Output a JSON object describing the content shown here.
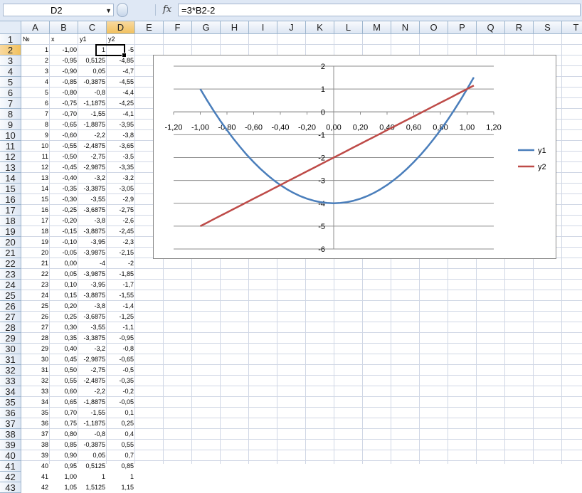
{
  "formula_bar": {
    "name_box": "D2",
    "fx_label": "fx",
    "formula": "=3*B2-2"
  },
  "columns": [
    "A",
    "B",
    "C",
    "D",
    "E",
    "F",
    "G",
    "H",
    "I",
    "J",
    "K",
    "L",
    "M",
    "N",
    "O",
    "P",
    "Q",
    "R",
    "S",
    "T"
  ],
  "selected_column": "D",
  "selected_row": 2,
  "rows": [
    1,
    2,
    3,
    4,
    5,
    6,
    7,
    8,
    9,
    10,
    11,
    12,
    13,
    14,
    15,
    16,
    17,
    18,
    19,
    20,
    21,
    22,
    23,
    24,
    25,
    26,
    27,
    28,
    29,
    30,
    31,
    32,
    33,
    34,
    35,
    36,
    37,
    38,
    39,
    40,
    41,
    42,
    43
  ],
  "header_row": [
    "№",
    "x",
    "y1",
    "y2"
  ],
  "table": [
    [
      "1",
      "-1,00",
      "1",
      "-5"
    ],
    [
      "2",
      "-0,95",
      "0,5125",
      "-4,85"
    ],
    [
      "3",
      "-0,90",
      "0,05",
      "-4,7"
    ],
    [
      "4",
      "-0,85",
      "-0,3875",
      "-4,55"
    ],
    [
      "5",
      "-0,80",
      "-0,8",
      "-4,4"
    ],
    [
      "6",
      "-0,75",
      "-1,1875",
      "-4,25"
    ],
    [
      "7",
      "-0,70",
      "-1,55",
      "-4,1"
    ],
    [
      "8",
      "-0,65",
      "-1,8875",
      "-3,95"
    ],
    [
      "9",
      "-0,60",
      "-2,2",
      "-3,8"
    ],
    [
      "10",
      "-0,55",
      "-2,4875",
      "-3,65"
    ],
    [
      "11",
      "-0,50",
      "-2,75",
      "-3,5"
    ],
    [
      "12",
      "-0,45",
      "-2,9875",
      "-3,35"
    ],
    [
      "13",
      "-0,40",
      "-3,2",
      "-3,2"
    ],
    [
      "14",
      "-0,35",
      "-3,3875",
      "-3,05"
    ],
    [
      "15",
      "-0,30",
      "-3,55",
      "-2,9"
    ],
    [
      "16",
      "-0,25",
      "-3,6875",
      "-2,75"
    ],
    [
      "17",
      "-0,20",
      "-3,8",
      "-2,6"
    ],
    [
      "18",
      "-0,15",
      "-3,8875",
      "-2,45"
    ],
    [
      "19",
      "-0,10",
      "-3,95",
      "-2,3"
    ],
    [
      "20",
      "-0,05",
      "-3,9875",
      "-2,15"
    ],
    [
      "21",
      "0,00",
      "-4",
      "-2"
    ],
    [
      "22",
      "0,05",
      "-3,9875",
      "-1,85"
    ],
    [
      "23",
      "0,10",
      "-3,95",
      "-1,7"
    ],
    [
      "24",
      "0,15",
      "-3,8875",
      "-1,55"
    ],
    [
      "25",
      "0,20",
      "-3,8",
      "-1,4"
    ],
    [
      "26",
      "0,25",
      "-3,6875",
      "-1,25"
    ],
    [
      "27",
      "0,30",
      "-3,55",
      "-1,1"
    ],
    [
      "28",
      "0,35",
      "-3,3875",
      "-0,95"
    ],
    [
      "29",
      "0,40",
      "-3,2",
      "-0,8"
    ],
    [
      "30",
      "0,45",
      "-2,9875",
      "-0,65"
    ],
    [
      "31",
      "0,50",
      "-2,75",
      "-0,5"
    ],
    [
      "32",
      "0,55",
      "-2,4875",
      "-0,35"
    ],
    [
      "33",
      "0,60",
      "-2,2",
      "-0,2"
    ],
    [
      "34",
      "0,65",
      "-1,8875",
      "-0,05"
    ],
    [
      "35",
      "0,70",
      "-1,55",
      "0,1"
    ],
    [
      "36",
      "0,75",
      "-1,1875",
      "0,25"
    ],
    [
      "37",
      "0,80",
      "-0,8",
      "0,4"
    ],
    [
      "38",
      "0,85",
      "-0,3875",
      "0,55"
    ],
    [
      "39",
      "0,90",
      "0,05",
      "0,7"
    ],
    [
      "40",
      "0,95",
      "0,5125",
      "0,85"
    ],
    [
      "41",
      "1,00",
      "1",
      "1"
    ],
    [
      "42",
      "1,05",
      "1,5125",
      "1,15"
    ]
  ],
  "chart_data": {
    "type": "line",
    "title": "",
    "xlabel": "",
    "ylabel": "",
    "xlim": [
      -1.2,
      1.2
    ],
    "ylim": [
      -6,
      2
    ],
    "x_ticks": [
      "-1,20",
      "-1,00",
      "-0,80",
      "-0,60",
      "-0,40",
      "-0,20",
      "0,00",
      "0,20",
      "0,40",
      "0,60",
      "0,80",
      "1,00",
      "1,20"
    ],
    "y_ticks": [
      "2",
      "1",
      "0",
      "-1",
      "-2",
      "-3",
      "-4",
      "-5",
      "-6"
    ],
    "grid": true,
    "legend": "right",
    "x": [
      -1.0,
      -0.95,
      -0.9,
      -0.85,
      -0.8,
      -0.75,
      -0.7,
      -0.65,
      -0.6,
      -0.55,
      -0.5,
      -0.45,
      -0.4,
      -0.35,
      -0.3,
      -0.25,
      -0.2,
      -0.15,
      -0.1,
      -0.05,
      0.0,
      0.05,
      0.1,
      0.15,
      0.2,
      0.25,
      0.3,
      0.35,
      0.4,
      0.45,
      0.5,
      0.55,
      0.6,
      0.65,
      0.7,
      0.75,
      0.8,
      0.85,
      0.9,
      0.95,
      1.0,
      1.05
    ],
    "series": [
      {
        "name": "y1",
        "color": "#4a7ebb",
        "values": [
          1,
          0.5125,
          0.05,
          -0.3875,
          -0.8,
          -1.1875,
          -1.55,
          -1.8875,
          -2.2,
          -2.4875,
          -2.75,
          -2.9875,
          -3.2,
          -3.3875,
          -3.55,
          -3.6875,
          -3.8,
          -3.8875,
          -3.95,
          -3.9875,
          -4,
          -3.9875,
          -3.95,
          -3.8875,
          -3.8,
          -3.6875,
          -3.55,
          -3.3875,
          -3.2,
          -2.9875,
          -2.75,
          -2.4875,
          -2.2,
          -1.8875,
          -1.55,
          -1.1875,
          -0.8,
          -0.3875,
          0.05,
          0.5125,
          1,
          1.5125
        ]
      },
      {
        "name": "y2",
        "color": "#be4b48",
        "values": [
          -5,
          -4.85,
          -4.7,
          -4.55,
          -4.4,
          -4.25,
          -4.1,
          -3.95,
          -3.8,
          -3.65,
          -3.5,
          -3.35,
          -3.2,
          -3.05,
          -2.9,
          -2.75,
          -2.6,
          -2.45,
          -2.3,
          -2.15,
          -2,
          -1.85,
          -1.7,
          -1.55,
          -1.4,
          -1.25,
          -1.1,
          -0.95,
          -0.8,
          -0.65,
          -0.5,
          -0.35,
          -0.2,
          -0.05,
          0.1,
          0.25,
          0.4,
          0.55,
          0.7,
          0.85,
          1,
          1.15
        ]
      }
    ]
  }
}
